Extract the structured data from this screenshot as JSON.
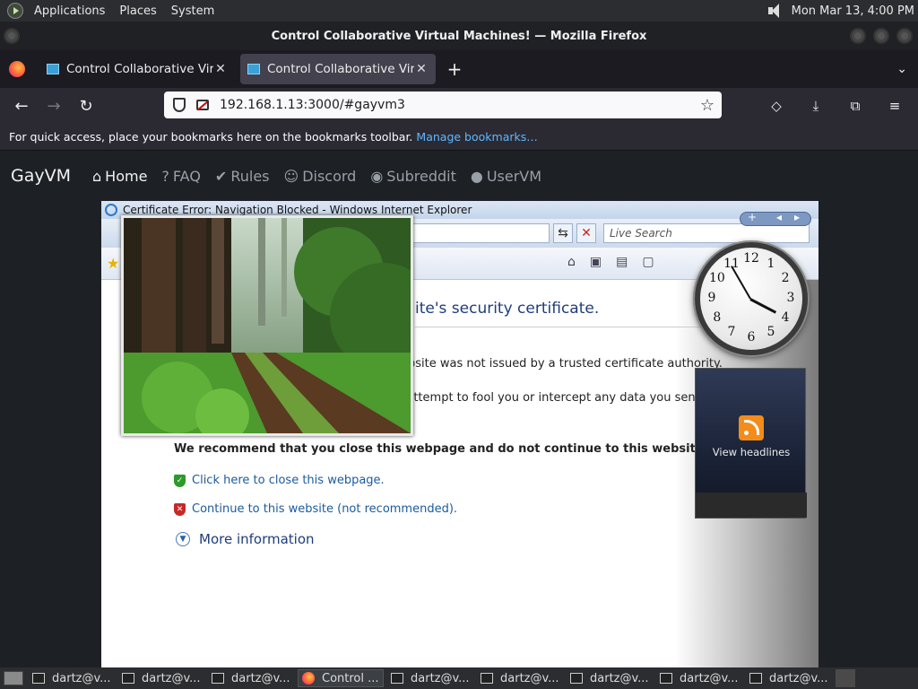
{
  "panel": {
    "menu": [
      "Applications",
      "Places",
      "System"
    ],
    "datetime": "Mon Mar 13,  4:00 PM"
  },
  "window": {
    "title": "Control Collaborative Virtual Machines! — Mozilla Firefox"
  },
  "tabs": [
    {
      "label": "Control Collaborative Virtual Machines!"
    },
    {
      "label": "Control Collaborative Virtual Machines!"
    }
  ],
  "tab_controls": {
    "new_tab": "+",
    "list": "⌄",
    "close": "✕"
  },
  "navbar": {
    "url": "192.168.1.13:3000/#gayvm3",
    "back": "←",
    "forward": "→",
    "reload": "↻",
    "star": "☆",
    "pocket": "◇",
    "downloads": "⤓",
    "extensions": "⧉",
    "menu": "≡"
  },
  "bookmarks": {
    "message": "For quick access, place your bookmarks here on the bookmarks toolbar.",
    "manage_link": "Manage bookmarks…"
  },
  "site": {
    "brand": "GayVM",
    "nav": [
      {
        "label": "Home",
        "icon": "⌂"
      },
      {
        "label": "FAQ",
        "icon": "?"
      },
      {
        "label": "Rules",
        "icon": "✔"
      },
      {
        "label": "Discord",
        "icon": "☺"
      },
      {
        "label": "Subreddit",
        "icon": "◉"
      },
      {
        "label": "UserVM",
        "icon": "●"
      }
    ]
  },
  "vm": {
    "ie_title": "Certificate Error: Navigation Blocked - Windows Internet Explorer",
    "live_search": "Live Search",
    "cert_heading": "ite's security certificate.",
    "cert_text1": "bsite was not issued by a trusted certificate authority.",
    "cert_text2": "n attempt to fool you or intercept any data you send",
    "recommend": "We recommend that you close this webpage and do not continue to this website.",
    "close_link": "Click here to close this webpage.",
    "continue_link": "Continue to this website (not recommended).",
    "more_info": "More information",
    "feed_label": "View headlines",
    "clock_numbers": [
      "12",
      "1",
      "2",
      "3",
      "4",
      "5",
      "6",
      "7",
      "8",
      "9",
      "10",
      "11"
    ],
    "clock_time": {
      "hour": 3,
      "minute": 55
    }
  },
  "taskbar": {
    "items": [
      {
        "label": "dartz@v...",
        "type": "terminal"
      },
      {
        "label": "dartz@v...",
        "type": "terminal"
      },
      {
        "label": "dartz@v...",
        "type": "terminal"
      },
      {
        "label": "Control ...",
        "type": "firefox"
      },
      {
        "label": "dartz@v...",
        "type": "terminal"
      },
      {
        "label": "dartz@v...",
        "type": "terminal"
      },
      {
        "label": "dartz@v...",
        "type": "terminal"
      },
      {
        "label": "dartz@v...",
        "type": "terminal"
      },
      {
        "label": "dartz@v...",
        "type": "terminal"
      }
    ]
  }
}
